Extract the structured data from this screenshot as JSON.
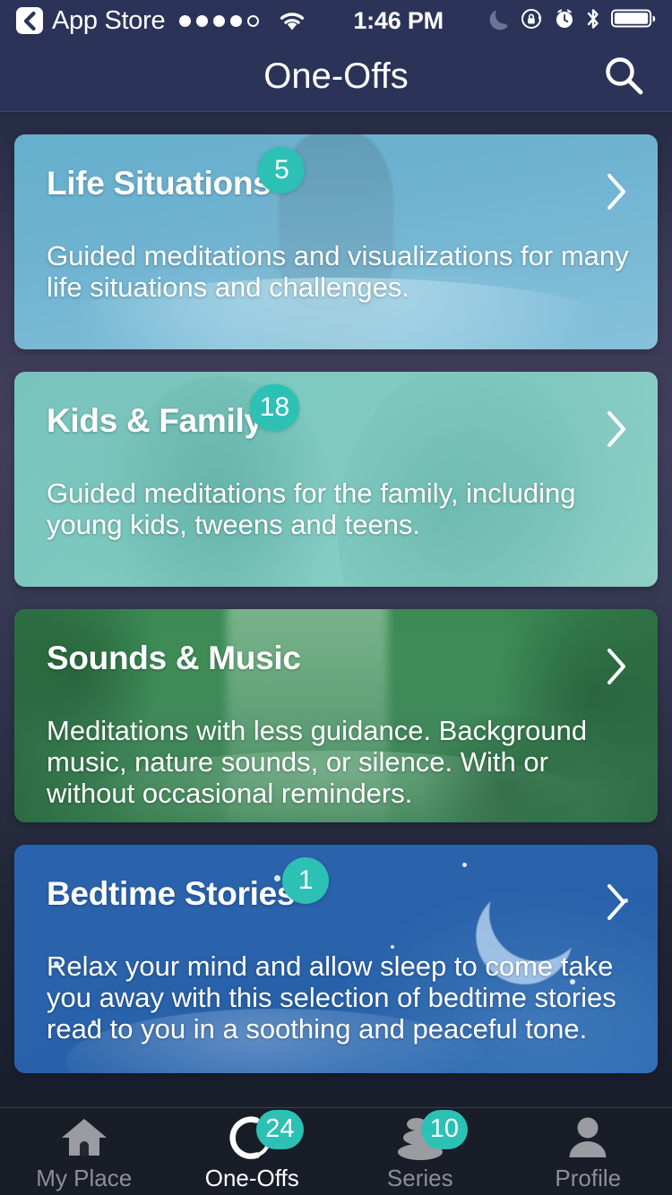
{
  "status_bar": {
    "back_label": "App Store",
    "back_icon": "chevron-left-icon",
    "signal_dots_filled": 4,
    "signal_dots_total": 5,
    "wifi_icon": "wifi-icon",
    "time": "1:46 PM",
    "right_icons": [
      "moon-icon",
      "rotation-lock-icon",
      "alarm-clock-icon",
      "bluetooth-icon",
      "battery-icon"
    ]
  },
  "header": {
    "title": "One-Offs",
    "search_icon": "search-icon"
  },
  "colors": {
    "badge": "#2DC0B5",
    "header_bg": "#2B3358",
    "tabbar_bg": "#191D27",
    "active_tab": "#FFFFFF",
    "inactive_tab": "#8D8F95"
  },
  "cards": [
    {
      "title": "Life Situations",
      "badge": "5",
      "description": "Guided meditations and visualizations for many life situations and challenges.",
      "chevron_icon": "chevron-right-icon"
    },
    {
      "title": "Kids & Family",
      "badge": "18",
      "description": "Guided meditations for the family, including young kids, tweens and teens.",
      "chevron_icon": "chevron-right-icon"
    },
    {
      "title": "Sounds & Music",
      "badge": "",
      "description": "Meditations with less guidance. Background music, nature sounds, or silence. With or without occasional reminders.",
      "chevron_icon": "chevron-right-icon"
    },
    {
      "title": "Bedtime Stories",
      "badge": "1",
      "description": "Relax your mind and allow sleep to come take you away with this selection of bedtime stories read to you in a soothing and peaceful tone.",
      "chevron_icon": "chevron-right-icon"
    }
  ],
  "tabs": [
    {
      "label": "My Place",
      "icon": "home-icon",
      "badge": "",
      "active": false
    },
    {
      "label": "One-Offs",
      "icon": "enso-circle-icon",
      "badge": "24",
      "active": true
    },
    {
      "label": "Series",
      "icon": "stacked-stones-icon",
      "badge": "10",
      "active": false
    },
    {
      "label": "Profile",
      "icon": "person-icon",
      "badge": "",
      "active": false
    }
  ]
}
